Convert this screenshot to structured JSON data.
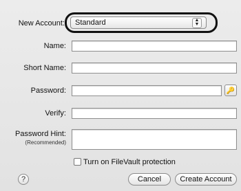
{
  "form": {
    "new_account_label": "New Account:",
    "new_account_value": "Standard",
    "name_label": "Name:",
    "short_name_label": "Short Name:",
    "password_label": "Password:",
    "verify_label": "Verify:",
    "password_hint_label": "Password Hint:",
    "password_hint_sublabel": "(Recommended)",
    "filevault_label": "Turn on FileVault protection",
    "help_glyph": "?",
    "key_glyph": "🔑",
    "popup_arrows_up": "▲",
    "popup_arrows_down": "▼"
  },
  "buttons": {
    "cancel": "Cancel",
    "create": "Create Account"
  }
}
